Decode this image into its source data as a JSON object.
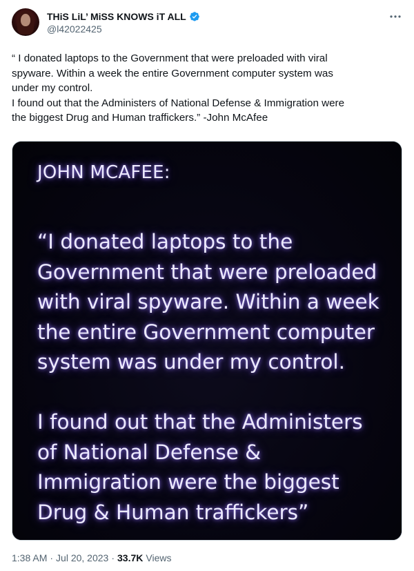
{
  "author": {
    "display_name": "THiS LiL’ MiSS KNOWS iT ALL",
    "handle": "@l42022425",
    "verified": true
  },
  "colors": {
    "verified_badge": "#1d9bf0",
    "secondary_text": "#536471",
    "primary_text": "#0f1419",
    "media_glow": "#9b7dff"
  },
  "tweet": {
    "text": "“ I donated laptops to the Government that were preloaded with viral\nspyware. Within a week the entire Government computer system was\nunder my control.\nI found out that the Administers  of National Defense & Immigration were\nthe biggest Drug and Human traffickers.” -John McAfee"
  },
  "media": {
    "title": "JOHN MCAFEE:",
    "paragraph_1": "“I donated laptops to the\nGovernment that were preloaded\nwith viral spyware. Within a week\nthe entire Government computer\nsystem was under my control.",
    "paragraph_2": "I found out that the Administers\nof National Defense &\nImmigration were the biggest\nDrug & Human traffickers”"
  },
  "meta": {
    "time": "1:38 AM",
    "separator": "·",
    "date": "Jul 20, 2023",
    "views_count": "33.7K",
    "views_label": "Views"
  },
  "icons": {
    "more": "more-horizontal-icon",
    "verified": "verified-badge-icon"
  }
}
